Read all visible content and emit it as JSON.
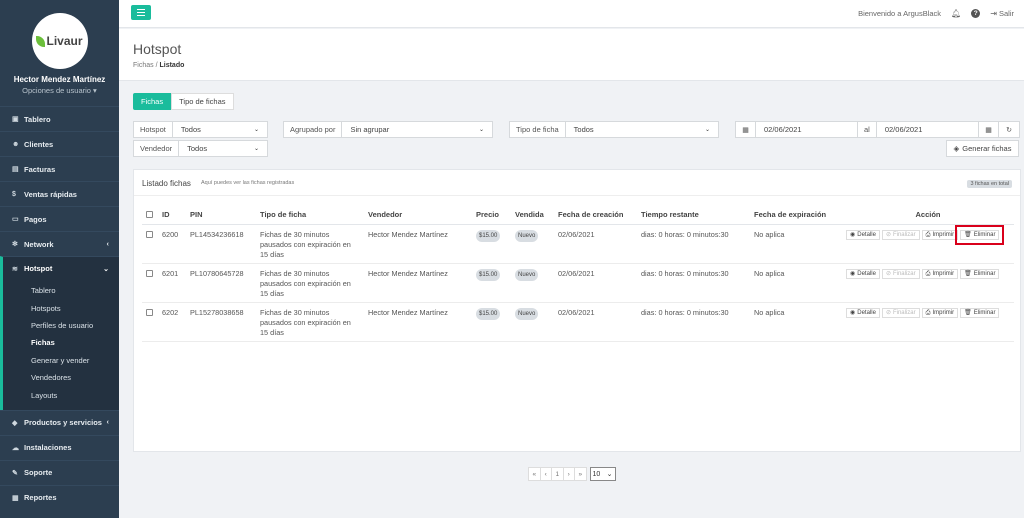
{
  "sidebar": {
    "logo_text": "Livaur",
    "user_name": "Hector Mendez Martínez",
    "user_options": "Opciones de usuario ▾",
    "items": [
      {
        "label": "Tablero",
        "icon": "dashboard-icon"
      },
      {
        "label": "Clientes",
        "icon": "users-icon"
      },
      {
        "label": "Facturas",
        "icon": "invoice-icon"
      },
      {
        "label": "Ventas rápidas",
        "icon": "dollar-icon"
      },
      {
        "label": "Pagos",
        "icon": "payments-icon"
      },
      {
        "label": "Network",
        "icon": "network-icon"
      },
      {
        "label": "Hotspot",
        "icon": "wifi-icon"
      },
      {
        "label": "Productos y servicios",
        "icon": "tag-icon"
      },
      {
        "label": "Instalaciones",
        "icon": "cloud-icon"
      },
      {
        "label": "Soporte",
        "icon": "wrench-icon"
      },
      {
        "label": "Reportes",
        "icon": "reports-icon"
      }
    ],
    "hotspot_sub": [
      "Tablero",
      "Hotspots",
      "Perfiles de usuario",
      "Fichas",
      "Generar y vender",
      "Vendedores",
      "Layouts"
    ]
  },
  "topbar": {
    "welcome": "Bienvenido a ArgusBlack",
    "logout": "Salir"
  },
  "header": {
    "title": "Hotspot",
    "breadcrumb_parent": "Fichas",
    "breadcrumb_sep": "/",
    "breadcrumb_current": "Listado"
  },
  "tabs": [
    "Fichas",
    "Tipo de fichas"
  ],
  "filters": {
    "hotspot_label": "Hotspot",
    "hotspot_value": "Todos",
    "grouped_label": "Agrupado por",
    "grouped_value": "Sin agrupar",
    "type_label": "Tipo de ficha",
    "type_value": "Todos",
    "date_from": "02/06/2021",
    "date_sep": "al",
    "date_to": "02/06/2021",
    "seller_label": "Vendedor",
    "seller_value": "Todos",
    "generate_button": "Generar fichas"
  },
  "panel": {
    "title": "Listado fichas",
    "subtitle": "Aquí puedes ver las fichas registradas",
    "count": "3 fichas en total"
  },
  "table": {
    "headers": [
      "ID",
      "PIN",
      "Tipo de ficha",
      "Vendedor",
      "Precio",
      "Vendida",
      "Fecha de creación",
      "Tiempo restante",
      "Fecha de expiración",
      "Acción"
    ],
    "rows": [
      {
        "id": "6200",
        "pin": "PL14534236618",
        "type": "Fichas de 30 minutos pausados con expiración en 15 días",
        "seller": "Hector Mendez Martínez",
        "price": "$15.00",
        "sold": "Nuevo",
        "created": "02/06/2021",
        "remaining": "dias: 0 horas: 0 minutos:30",
        "expires": "No aplica"
      },
      {
        "id": "6201",
        "pin": "PL10780645728",
        "type": "Fichas de 30 minutos pausados con expiración en 15 días",
        "seller": "Hector Mendez Martínez",
        "price": "$15.00",
        "sold": "Nuevo",
        "created": "02/06/2021",
        "remaining": "dias: 0 horas: 0 minutos:30",
        "expires": "No aplica"
      },
      {
        "id": "6202",
        "pin": "PL15278038658",
        "type": "Fichas de 30 minutos pausados con expiración en 15 días",
        "seller": "Hector Mendez Martínez",
        "price": "$15.00",
        "sold": "Nuevo",
        "created": "02/06/2021",
        "remaining": "dias: 0 horas: 0 minutos:30",
        "expires": "No aplica"
      }
    ],
    "actions": {
      "detail": "Detalle",
      "finalize": "Finalizar",
      "print": "Imprimir",
      "delete": "Eliminar"
    }
  },
  "pagination": {
    "first": "«",
    "prev": "‹",
    "page": "1",
    "next": "›",
    "last": "»",
    "page_size": "10"
  },
  "colors": {
    "accent": "#1abc9c",
    "sidebar": "#2c3e50",
    "highlight": "#d9001b"
  }
}
